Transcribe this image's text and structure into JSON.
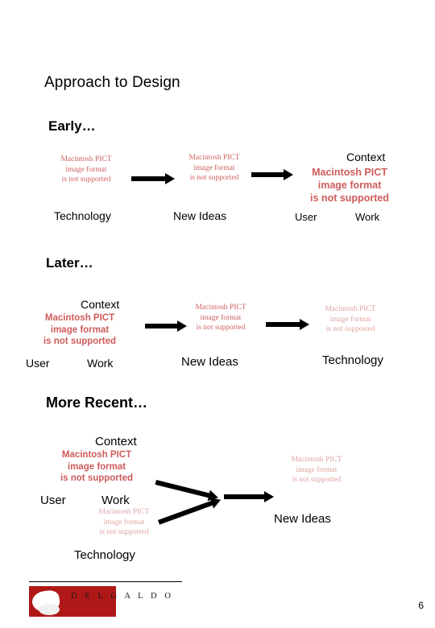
{
  "slide": {
    "title": "Approach to Design",
    "page_number": "6",
    "logo_text": "D  E  L  G  A  L  D  O",
    "pict_placeholder": "Macintosh PICT\nimage format\nis not supported",
    "sections": [
      {
        "heading": "Early…",
        "labels": [
          "Technology",
          "New Ideas",
          "User",
          "Work",
          "Context"
        ]
      },
      {
        "heading": "Later…",
        "labels": [
          "Context",
          "User",
          "Work",
          "New Ideas",
          "Technology"
        ]
      },
      {
        "heading": "More Recent…",
        "labels": [
          "Context",
          "User",
          "Work",
          "Technology",
          "New Ideas"
        ]
      }
    ]
  }
}
